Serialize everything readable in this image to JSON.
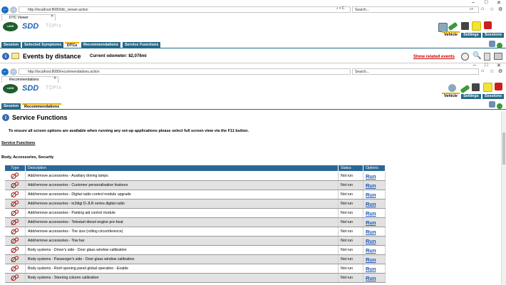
{
  "browser1": {
    "address": "http://localhost:8080/dtc_viewer.action",
    "search_placeholder": "Search...",
    "tab_title": "DTC Viewer"
  },
  "browser2": {
    "address": "http://localhost:8080/recommendations.action",
    "search_placeholder": "Search...",
    "tab_title": "Recommendations"
  },
  "header": {
    "logo_text": "LAND ROVER",
    "app_name": "SDD",
    "sub_name": "TOPIx",
    "buttons": [
      "Vehicle",
      "Settings",
      "Sessions"
    ]
  },
  "menu1": {
    "tabs": [
      "Session",
      "Selected Symptoms",
      "DTCs",
      "Recommendations",
      "Service Functions"
    ]
  },
  "events": {
    "title": "Events by distance",
    "odometer_label": "Current odometer:",
    "odometer_value": "82,076mi",
    "related_link": "Show related events"
  },
  "menu2": {
    "tabs": [
      "Session",
      "Recommendations"
    ]
  },
  "service": {
    "title": "Service Functions",
    "notice": "To ensure all screen options are available when running any set-up applications please select full screen view via the F11 button.",
    "link": "Service Functions",
    "section": "Body, Accessories, Security",
    "columns": [
      "Type",
      "Description",
      "Status",
      "Options"
    ],
    "rows": [
      {
        "desc": "Add/remove accessories - Auxiliary driving lamps",
        "status": "Not run",
        "option": "Run"
      },
      {
        "desc": "Add/remove accessories - Customer personalisation features",
        "status": "Not run",
        "option": "Run"
      },
      {
        "desc": "Add/remove accessories - Digital radio control module upgrade",
        "status": "Not run",
        "option": "Run"
      },
      {
        "desc": "Add/remove accessories - in2digi D-JLR series digital radio",
        "status": "Not run",
        "option": "Run"
      },
      {
        "desc": "Add/remove accessories - Parking aid control module",
        "status": "Not run",
        "option": "Run"
      },
      {
        "desc": "Add/remove accessories - Telestart diesel engine pre-heat",
        "status": "Not run",
        "option": "Run"
      },
      {
        "desc": "Add/remove accessories - Tire size (rolling circumference)",
        "status": "Not run",
        "option": "Run"
      },
      {
        "desc": "Add/remove accessories - Tow bar",
        "status": "Not run",
        "option": "Run"
      },
      {
        "desc": "Body systems - Driver's side - Door glass window calibration",
        "status": "Not run",
        "option": "Run"
      },
      {
        "desc": "Body systems - Passenger's side - Door glass window calibration",
        "status": "Not run",
        "option": "Run"
      },
      {
        "desc": "Body systems - Roof opening panel global operation - Enable",
        "status": "Not run",
        "option": "Run"
      },
      {
        "desc": "Body systems - Steering column calibration",
        "status": "Not run",
        "option": "Run"
      }
    ]
  },
  "colors": {
    "accent": "#256a8a",
    "table_header": "#2b6796",
    "link_red": "#cc0000",
    "run_blue": "#1d58b4"
  }
}
